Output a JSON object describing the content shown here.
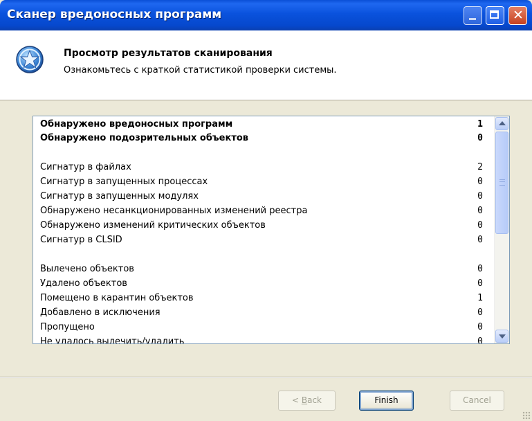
{
  "window": {
    "title": "Сканер вредоносных программ"
  },
  "header": {
    "title": "Просмотр результатов сканирования",
    "subtitle": "Ознакомьтесь с краткой статистикой проверки системы.",
    "icon": "star-shield-icon"
  },
  "stats": {
    "rows": [
      {
        "label": "Обнаружено вредоносных программ",
        "value": "1",
        "bold": true
      },
      {
        "label": "Обнаружено подозрительных объектов",
        "value": "0",
        "bold": true
      },
      {
        "label": "Сигнатур в файлах",
        "value": "2",
        "bold": false
      },
      {
        "label": "Сигнатур в запущенных процессах",
        "value": "0",
        "bold": false
      },
      {
        "label": "Сигнатур в запущенных модулях",
        "value": "0",
        "bold": false
      },
      {
        "label": "Обнаружено несанкционированных изменений реестра",
        "value": "0",
        "bold": false
      },
      {
        "label": "Обнаружено изменений критических объектов",
        "value": "0",
        "bold": false
      },
      {
        "label": "Сигнатур в CLSID",
        "value": "0",
        "bold": false
      },
      {
        "label": "Вылечено объектов",
        "value": "0",
        "bold": false
      },
      {
        "label": "Удалено объектов",
        "value": "0",
        "bold": false
      },
      {
        "label": "Помещено в карантин объектов",
        "value": "1",
        "bold": false
      },
      {
        "label": "Добавлено в исключения",
        "value": "0",
        "bold": false
      },
      {
        "label": "Пропущено",
        "value": "0",
        "bold": false
      },
      {
        "label": "Не удалось вылечить/удалить",
        "value": "0",
        "bold": false
      }
    ]
  },
  "buttons": {
    "back": "< Back",
    "finish": "Finish",
    "cancel": "Cancel"
  }
}
